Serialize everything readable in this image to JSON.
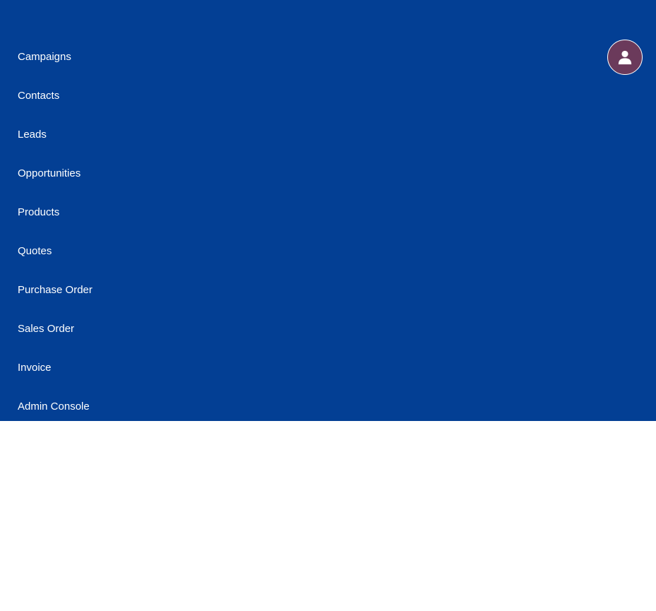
{
  "nav": {
    "items": [
      {
        "label": "Campaigns"
      },
      {
        "label": "Contacts"
      },
      {
        "label": "Leads"
      },
      {
        "label": "Opportunities"
      },
      {
        "label": "Products"
      },
      {
        "label": "Quotes"
      },
      {
        "label": "Purchase Order"
      },
      {
        "label": "Sales Order"
      },
      {
        "label": "Invoice"
      },
      {
        "label": "Admin Console"
      }
    ]
  },
  "user": {
    "avatar_icon": "user-icon",
    "avatar_color": "#6b3a5b"
  },
  "theme": {
    "nav_background": "#033f94",
    "nav_text": "#ffffff"
  }
}
